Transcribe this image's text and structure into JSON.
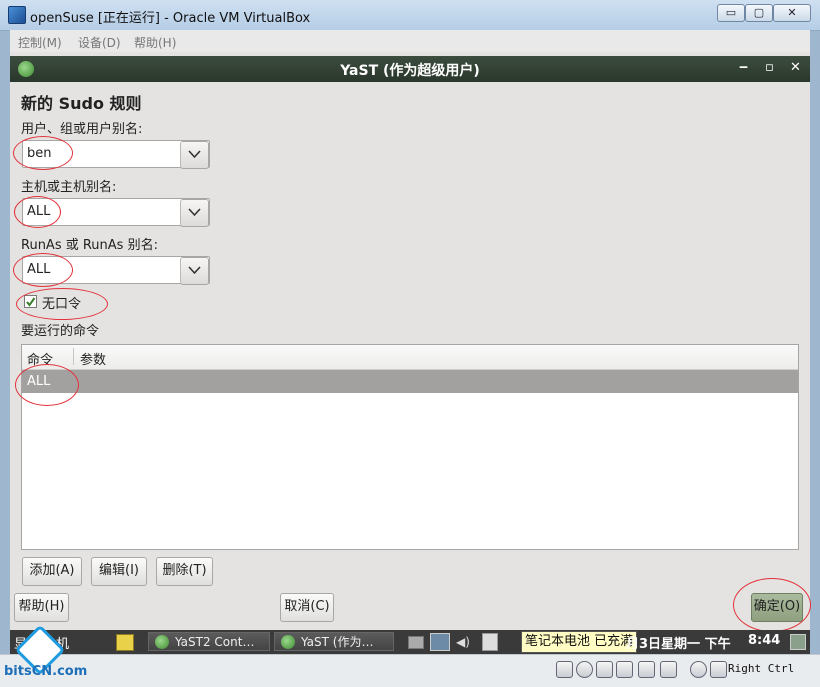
{
  "host": {
    "title": "openSuse [正在运行] - Oracle VM VirtualBox",
    "controls": {
      "minimize": "▭",
      "maximize": "▢",
      "close": "✕"
    },
    "menu": [
      "控制(M)",
      "设备(D)",
      "帮助(H)"
    ],
    "host_key": "Right Ctrl"
  },
  "guest": {
    "window_title": "YaST (作为超级用户)",
    "window_controls": {
      "minimize": "‒",
      "maximize": "▫",
      "close": "✕"
    },
    "page_title": "新的 Sudo 规则",
    "fields": {
      "user_label": "用户、组或用户别名:",
      "user_value": "ben",
      "host_label": "主机或主机别名:",
      "host_value": "ALL",
      "runas_label": "RunAs 或 RunAs 别名:",
      "runas_value": "ALL"
    },
    "nopasswd": {
      "label": "无口令",
      "checked": true
    },
    "commands_label": "要运行的命令",
    "table": {
      "columns": [
        "命令",
        "参数"
      ],
      "rows": [
        {
          "command": "ALL",
          "args": ""
        }
      ]
    },
    "buttons": {
      "add": "添加(A)",
      "edit": "编辑(I)",
      "delete": "删除(T)",
      "help": "帮助(H)",
      "cancel": "取消(C)",
      "ok": "确定(O)"
    }
  },
  "taskbar": {
    "start": "显",
    "start_suffix": "机",
    "tasks": [
      "YaST2 Cont…",
      "YaST (作为…"
    ],
    "battery_tooltip": "笔记本电池 已充满",
    "date": "月3日星期一 下午",
    "time": "8:44"
  },
  "watermark": "bitsCN.com",
  "colors": {
    "annotation": "#e3323a",
    "selected_row": "#a2a19f",
    "guest_titlebar": "#2f3d31"
  }
}
